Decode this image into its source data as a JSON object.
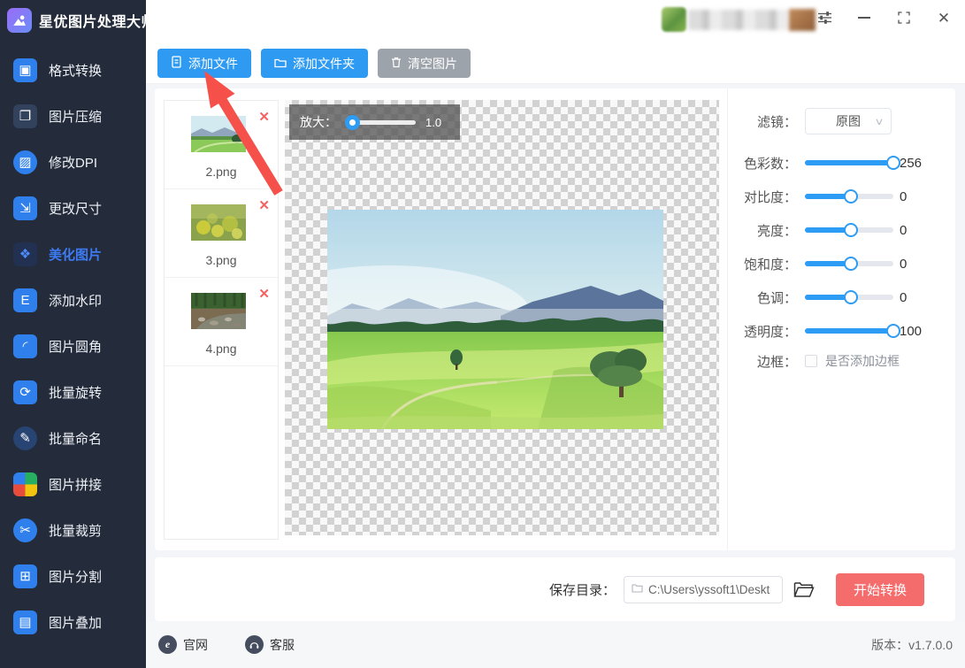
{
  "app": {
    "title": "星优图片处理大师",
    "logo_icon": "app-logo-image-icon"
  },
  "sidebar": {
    "items": [
      {
        "label": "格式转换",
        "icon": "format-convert-icon",
        "active": false
      },
      {
        "label": "图片压缩",
        "icon": "image-compress-icon",
        "active": false
      },
      {
        "label": "修改DPI",
        "icon": "modify-dpi-icon",
        "active": false
      },
      {
        "label": "更改尺寸",
        "icon": "resize-icon",
        "active": false
      },
      {
        "label": "美化图片",
        "icon": "beautify-image-icon",
        "active": true
      },
      {
        "label": "添加水印",
        "icon": "add-watermark-icon",
        "active": false
      },
      {
        "label": "图片圆角",
        "icon": "round-corner-icon",
        "active": false
      },
      {
        "label": "批量旋转",
        "icon": "batch-rotate-icon",
        "active": false
      },
      {
        "label": "批量命名",
        "icon": "batch-rename-icon",
        "active": false
      },
      {
        "label": "图片拼接",
        "icon": "image-stitch-icon",
        "active": false
      },
      {
        "label": "批量裁剪",
        "icon": "batch-crop-icon",
        "active": false
      },
      {
        "label": "图片分割",
        "icon": "image-split-icon",
        "active": false
      },
      {
        "label": "图片叠加",
        "icon": "image-overlay-icon",
        "active": false
      }
    ]
  },
  "toolbar": {
    "add_file": "添加文件",
    "add_folder": "添加文件夹",
    "clear": "清空图片"
  },
  "titlebar": {
    "icons": [
      "tune-icon",
      "minimize-icon",
      "maximize-icon",
      "close-icon"
    ]
  },
  "files": [
    {
      "name": "2.png",
      "thumb": "green-landscape"
    },
    {
      "name": "3.png",
      "thumb": "yellow-flowers"
    },
    {
      "name": "4.png",
      "thumb": "forest-stream"
    }
  ],
  "preview": {
    "zoom_label": "放大：",
    "zoom_value": "1.0"
  },
  "controls": {
    "filter_label": "滤镜：",
    "filter_value": "原图",
    "sliders": [
      {
        "key": "colors-count",
        "label": "色彩数：",
        "value": "256",
        "pct": 100
      },
      {
        "key": "contrast",
        "label": "对比度：",
        "value": "0",
        "pct": 52
      },
      {
        "key": "brightness",
        "label": "亮度：",
        "value": "0",
        "pct": 52
      },
      {
        "key": "saturation",
        "label": "饱和度：",
        "value": "0",
        "pct": 52
      },
      {
        "key": "hue",
        "label": "色调：",
        "value": "0",
        "pct": 52
      },
      {
        "key": "opacity",
        "label": "透明度：",
        "value": "100",
        "pct": 100
      }
    ],
    "border_label": "边框：",
    "border_option": "是否添加边框",
    "border_checked": false
  },
  "save_bar": {
    "label": "保存目录：",
    "path": "C:\\Users\\yssoft1\\Deskt",
    "start": "开始转换"
  },
  "footer": {
    "website": "官网",
    "support": "客服",
    "version": "版本：v1.7.0.0"
  },
  "colors": {
    "accent_blue": "#2e9af2",
    "slider_blue": "#2d9cf4",
    "active_blue": "#3d7bf5",
    "danger_red": "#f56c6c",
    "arrow_red": "#f6504a",
    "sidebar_bg": "#242b3a"
  }
}
